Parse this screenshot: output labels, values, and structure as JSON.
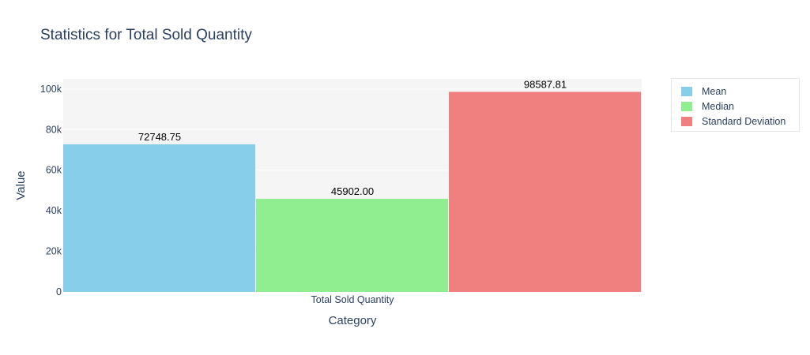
{
  "chart_data": {
    "type": "bar",
    "title": "Statistics for Total Sold Quantity",
    "xlabel": "Category",
    "ylabel": "Value",
    "categories": [
      "Total Sold Quantity"
    ],
    "ylim": [
      0,
      105000
    ],
    "yticks": [
      0,
      20000,
      40000,
      60000,
      80000,
      100000
    ],
    "ytick_labels": [
      "0",
      "20k",
      "40k",
      "60k",
      "80k",
      "100k"
    ],
    "grid": true,
    "legend_position": "top-right",
    "series": [
      {
        "name": "Mean",
        "values": [
          72748.75
        ],
        "label": "72748.75",
        "color": "#87ceeb"
      },
      {
        "name": "Median",
        "values": [
          45902.0
        ],
        "label": "45902.00",
        "color": "#90ee90"
      },
      {
        "name": "Standard Deviation",
        "values": [
          98587.81
        ],
        "label": "98587.81",
        "color": "#f08080"
      }
    ],
    "plot_background": "#f5f5f5",
    "grid_color": "#ffffff"
  }
}
